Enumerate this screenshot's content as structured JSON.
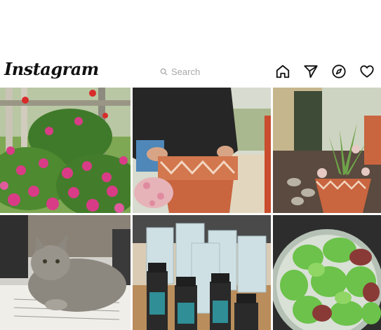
{
  "header": {
    "logo_text": "Instagram",
    "search_placeholder": "Search",
    "icons": [
      "home-icon",
      "direct-icon",
      "explore-icon",
      "heart-icon"
    ]
  },
  "grid": {
    "posts": [
      {
        "subject": "pink petunias"
      },
      {
        "subject": "terracotta pot"
      },
      {
        "subject": "potted succulent"
      },
      {
        "subject": "tabby cat"
      },
      {
        "subject": "skincare products"
      },
      {
        "subject": "lettuce bowl"
      }
    ]
  },
  "colors": {
    "text": "#111111",
    "placeholder": "#a8a8a8",
    "terracotta": "#c9653f",
    "petunia": "#d93c86",
    "lettuce": "#6cc24a"
  }
}
